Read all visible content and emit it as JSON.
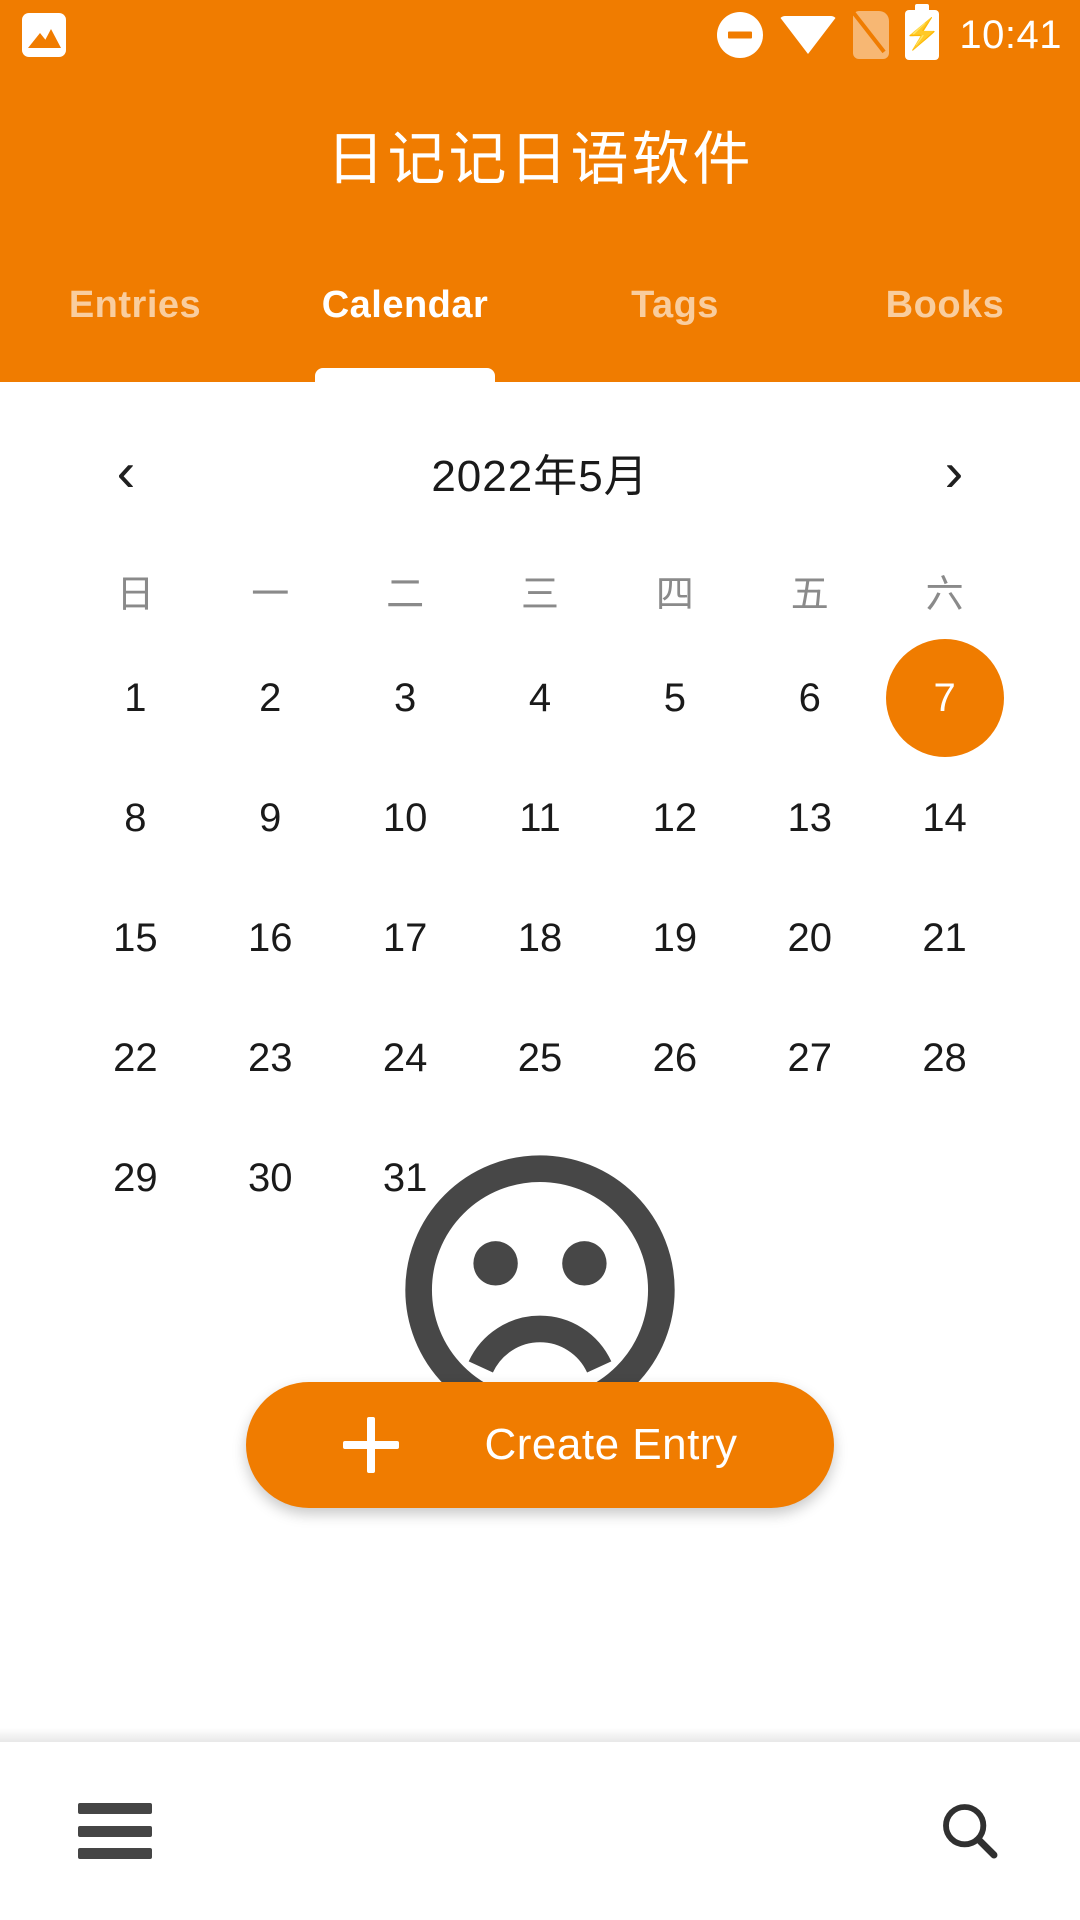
{
  "status_bar": {
    "time": "10:41",
    "icons": {
      "notification": "photo-icon",
      "dnd": "do-not-disturb-icon",
      "wifi": "wifi-icon",
      "sim": "sim-card-off-icon",
      "battery": "battery-charging-icon"
    }
  },
  "app_bar": {
    "title": "日记记日语软件",
    "accent_color": "#F07C00",
    "tabs": [
      {
        "label": "Entries",
        "active": false
      },
      {
        "label": "Calendar",
        "active": true
      },
      {
        "label": "Tags",
        "active": false
      },
      {
        "label": "Books",
        "active": false
      }
    ]
  },
  "calendar": {
    "prev_icon": "chevron-left-icon",
    "next_icon": "chevron-right-icon",
    "month_label": "2022年5月",
    "weekday_headers": [
      "日",
      "一",
      "二",
      "三",
      "四",
      "五",
      "六"
    ],
    "weeks": [
      [
        "1",
        "2",
        "3",
        "4",
        "5",
        "6",
        "7"
      ],
      [
        "8",
        "9",
        "10",
        "11",
        "12",
        "13",
        "14"
      ],
      [
        "15",
        "16",
        "17",
        "18",
        "19",
        "20",
        "21"
      ],
      [
        "22",
        "23",
        "24",
        "25",
        "26",
        "27",
        "28"
      ],
      [
        "29",
        "30",
        "31",
        "",
        "",
        "",
        ""
      ]
    ],
    "selected_day": "7",
    "selected_color": "#F07C00"
  },
  "empty_state": {
    "icon": "sad-face-icon",
    "icon_color": "#474747"
  },
  "fab": {
    "label": "Create Entry",
    "icon": "plus-icon",
    "color": "#F07C00"
  },
  "bottom_bar": {
    "menu_icon": "hamburger-menu-icon",
    "search_icon": "search-icon"
  }
}
